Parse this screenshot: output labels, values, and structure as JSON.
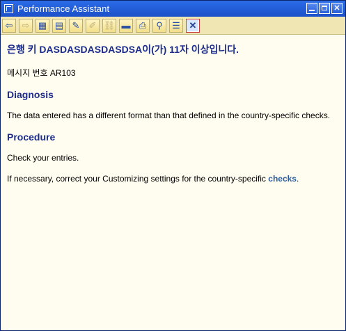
{
  "window": {
    "title": "Performance Assistant"
  },
  "titlebar": {
    "buttons": [
      {
        "name": "minimize",
        "glyph": ""
      },
      {
        "name": "maximize",
        "glyph": ""
      },
      {
        "name": "close",
        "glyph": "✕"
      }
    ]
  },
  "toolbar": {
    "tools": [
      {
        "name": "back-button",
        "icon": "arrow-left-icon",
        "glyph": "⇦",
        "dim": false
      },
      {
        "name": "forward-button",
        "icon": "arrow-right-icon",
        "glyph": "⇨",
        "dim": true
      },
      {
        "name": "tool-3",
        "icon": "grid-icon",
        "glyph": "▦",
        "dim": false
      },
      {
        "name": "tool-4",
        "icon": "hierarchy-icon",
        "glyph": "▤",
        "dim": false
      },
      {
        "name": "tool-5",
        "icon": "edit-icon",
        "glyph": "✎",
        "dim": false
      },
      {
        "name": "tool-6",
        "icon": "pencil-icon",
        "glyph": "✐",
        "dim": true
      },
      {
        "name": "tool-7",
        "icon": "link-icon",
        "glyph": "⛓",
        "dim": true
      },
      {
        "name": "tool-8",
        "icon": "window-icon",
        "glyph": "▬",
        "dim": false
      },
      {
        "name": "print-button",
        "icon": "printer-icon",
        "glyph": "⎙",
        "dim": false
      },
      {
        "name": "find-button",
        "icon": "binoculars-icon",
        "glyph": "⚲",
        "dim": false
      },
      {
        "name": "tool-11",
        "icon": "list-icon",
        "glyph": "☰",
        "dim": false
      },
      {
        "name": "close-assistant-button",
        "icon": "close-icon",
        "glyph": "✕",
        "dim": false
      }
    ]
  },
  "content": {
    "heading": "은행 키 DASDASDASDASDSA이(가) 11자 이상입니다.",
    "message_number": "메시지 번호 AR103",
    "diagnosis_title": "Diagnosis",
    "diagnosis_text": "The data entered has a different format than that defined in the country-specific checks.",
    "procedure_title": "Procedure",
    "procedure_text1": "Check your entries.",
    "procedure_text2_pre": "If necessary, correct your Customizing settings for the country-specific ",
    "procedure_link": "checks",
    "procedure_text2_post": "."
  },
  "colors": {
    "title_bar": "#2361e0",
    "toolbar": "#efe6b4",
    "background": "#fffdf0",
    "heading": "#1c2c8c",
    "link": "#2c5c9a"
  }
}
